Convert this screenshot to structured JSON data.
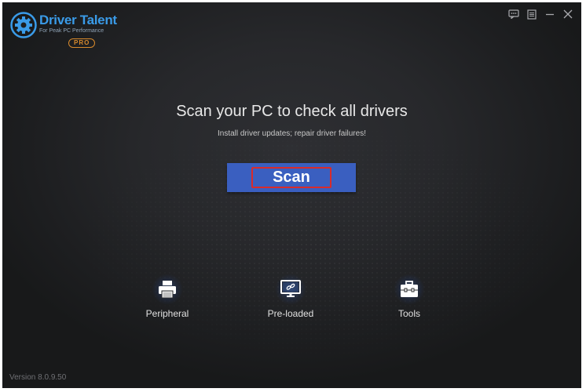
{
  "app": {
    "name": "Driver Talent",
    "tagline": "For Peak PC Performance",
    "edition": "PRO",
    "brand_color": "#3a9be8",
    "edition_color": "#d88a2c"
  },
  "window_controls": {
    "feedback": "feedback-icon",
    "menu": "menu-icon",
    "minimize": "minimize-icon",
    "close": "close-icon"
  },
  "main": {
    "headline": "Scan your PC to check all drivers",
    "subline": "Install driver updates; repair driver failures!",
    "scan_button": "Scan",
    "scan_button_color": "#3a5fc0",
    "highlight_color": "#d92b2b"
  },
  "features": [
    {
      "label": "Peripheral",
      "icon": "printer-icon"
    },
    {
      "label": "Pre-loaded",
      "icon": "monitor-link-icon"
    },
    {
      "label": "Tools",
      "icon": "toolbox-icon"
    }
  ],
  "footer": {
    "version": "Version 8.0.9.50"
  }
}
